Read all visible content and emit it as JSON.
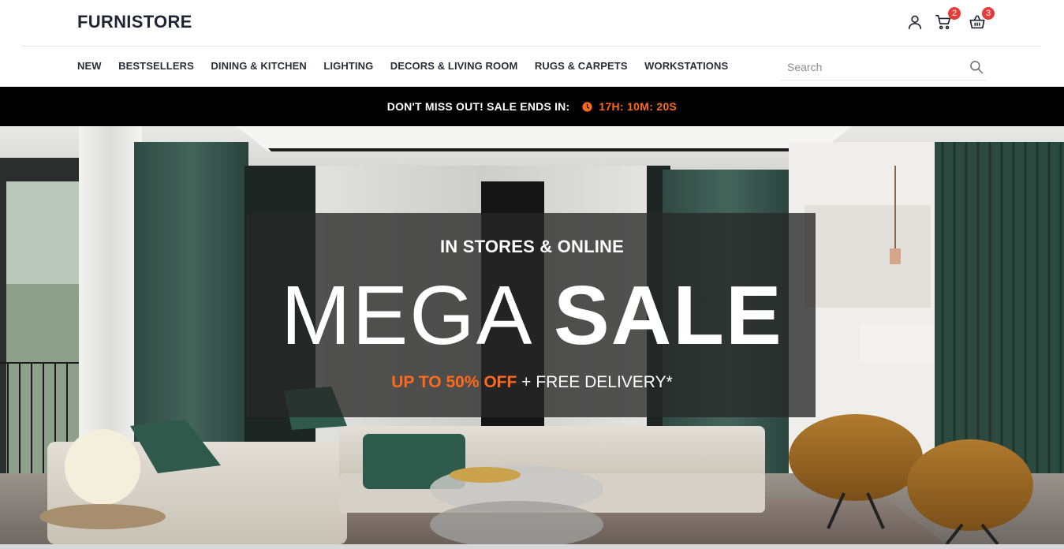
{
  "brand": {
    "logo": "FURNISTORE"
  },
  "header": {
    "icons": [
      {
        "name": "user-icon"
      },
      {
        "name": "cart-icon",
        "badge": "2"
      },
      {
        "name": "basket-icon",
        "badge": "3"
      }
    ]
  },
  "nav": {
    "items": [
      "NEW",
      "BESTSELLERS",
      "DINING & KITCHEN",
      "LIGHTING",
      "DECORS & LIVING ROOM",
      "RUGS & CARPETS",
      "WORKSTATIONS"
    ],
    "search": {
      "placeholder": "Search",
      "value": ""
    }
  },
  "promo": {
    "text": "DON'T MISS OUT! SALE ENDS IN:",
    "countdown": "17H: 10M: 20S",
    "accent_color": "#ff6a1a"
  },
  "hero": {
    "subtitle": "IN STORES & ONLINE",
    "title_light": "MEGA",
    "title_bold": "SALE",
    "offer_highlight": "UP TO 50% OFF",
    "offer_rest": "+ FREE DELIVERY*"
  },
  "colors": {
    "badge": "#e53b3b",
    "promo_bg": "#000000",
    "overlay": "#282828"
  }
}
